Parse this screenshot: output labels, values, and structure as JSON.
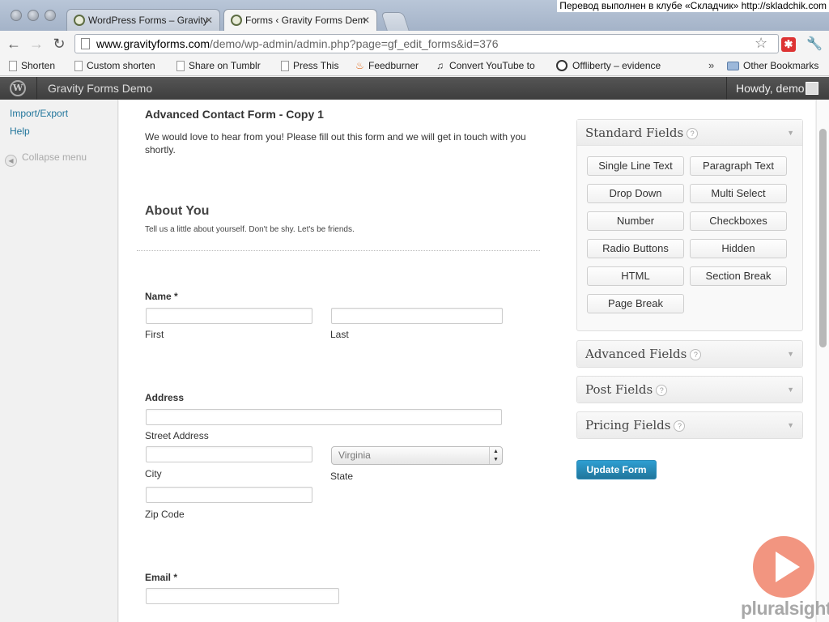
{
  "browser": {
    "tabs": [
      {
        "title": "WordPress Forms – Gravity"
      },
      {
        "title": "Forms ‹ Gravity Forms Dem"
      }
    ],
    "overlay_note": "Перевод выполнен в клубе «Складчик» http://skladchik.com",
    "url_host": "www.gravityforms.com",
    "url_path": "/demo/wp-admin/admin.php?page=gf_edit_forms&id=376",
    "bookmarks": [
      {
        "label": "Shorten",
        "icon": "page-icon"
      },
      {
        "label": "Custom shorten",
        "icon": "page-icon"
      },
      {
        "label": "Share on Tumblr",
        "icon": "page-icon"
      },
      {
        "label": "Press This",
        "icon": "page-icon"
      },
      {
        "label": "Feedburner",
        "icon": "flame-icon"
      },
      {
        "label": "Convert YouTube to",
        "icon": "music-note-icon"
      },
      {
        "label": "Offliberty – evidence",
        "icon": "power-icon"
      }
    ],
    "chevron": "»",
    "other_bookmarks": "Other Bookmarks"
  },
  "adminbar": {
    "site_name": "Gravity Forms Demo",
    "howdy": "Howdy, demo"
  },
  "sidebar": {
    "links": [
      "Import/Export",
      "Help"
    ],
    "collapse": "Collapse menu"
  },
  "form": {
    "title": "Advanced Contact Form - Copy 1",
    "description": "We would love to hear from you! Please fill out this form and we will get in touch with you shortly.",
    "section_title": "About You",
    "section_desc": "Tell us a little about yourself. Don't be shy. Let's be friends.",
    "name_label": "Name",
    "required_mark": "*",
    "first": "First",
    "last": "Last",
    "address_label": "Address",
    "street": "Street Address",
    "city": "City",
    "state_value": "Virginia",
    "state": "State",
    "zip": "Zip Code",
    "email_label": "Email"
  },
  "panels": {
    "standard": {
      "title": "Standard Fields",
      "buttons": [
        "Single Line Text",
        "Paragraph Text",
        "Drop Down",
        "Multi Select",
        "Number",
        "Checkboxes",
        "Radio Buttons",
        "Hidden",
        "HTML",
        "Section Break",
        "Page Break"
      ]
    },
    "advanced": {
      "title": "Advanced Fields"
    },
    "post": {
      "title": "Post Fields"
    },
    "pricing": {
      "title": "Pricing Fields"
    },
    "help_glyph": "?",
    "update_button": "Update Form"
  },
  "watermark": {
    "text": "pluralsight"
  },
  "colors": {
    "link": "#21759b",
    "primary_button": "#21759b",
    "admin_bar": "#464646"
  }
}
